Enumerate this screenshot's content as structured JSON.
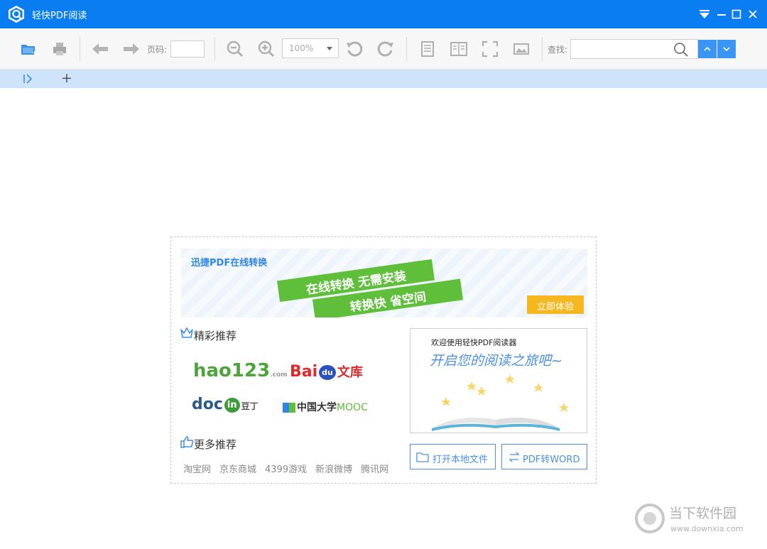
{
  "app": {
    "title": "轻快PDF阅读"
  },
  "toolbar": {
    "page_label": "页码:",
    "page_value": "",
    "zoom_value": "100%",
    "search_label": "查找:",
    "search_value": ""
  },
  "tabbar": {
    "add_label": "+"
  },
  "banner": {
    "brand": "迅捷PDF在线转换",
    "line1": "在线转换 无需安装",
    "line2": "转换快 省空间",
    "try_button": "立即体验"
  },
  "recommend": {
    "title": "精彩推荐",
    "logos": [
      {
        "text": "hao123",
        "suffix": ".com"
      },
      {
        "text": "Bai",
        "mid": "du",
        "suffix": "文库"
      },
      {
        "text": "doc",
        "mid": "in",
        "suffix": "豆丁"
      },
      {
        "text": "中国大学",
        "suffix": "MOOC"
      }
    ]
  },
  "more": {
    "title": "更多推荐",
    "links": [
      "淘宝网",
      "京东商城",
      "4399游戏",
      "新浪微博",
      "腾讯网"
    ]
  },
  "welcome": {
    "small": "欢迎使用轻快PDF阅读器",
    "large": "开启您的阅读之旅吧~"
  },
  "actions": {
    "open_local": "打开本地文件",
    "pdf_to_word": "PDF转WORD"
  },
  "watermark": {
    "name": "当下软件园",
    "url": "www.downxia.com"
  },
  "colors": {
    "titlebar": "#0a7ef0",
    "tabbar": "#cfe4fb",
    "accent": "#4a90e2",
    "ribbon": "#5fbf3a",
    "try": "#f6b821"
  }
}
